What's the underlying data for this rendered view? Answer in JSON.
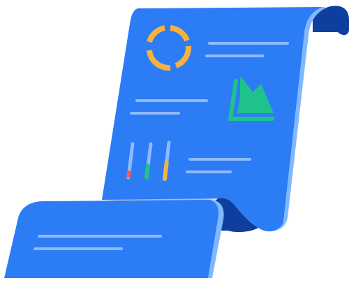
{
  "illustration": {
    "subject": "rolled-report-scroll",
    "icons": [
      "ring-chart-icon",
      "area-chart-icon",
      "progress-bars-icon"
    ],
    "colors": {
      "paper": "#2c7cf6",
      "paper_shade": "#1f5fd0",
      "roll_dark": "#0e3f9e",
      "paper_edge": "#7fb8ff",
      "text_line": "#8fbaff",
      "ring_chart": "#f6b23e",
      "area_chart": "#1fc28a",
      "bar_red": "#f25a5a",
      "bar_green": "#23c27d",
      "bar_orange": "#f6b23e"
    },
    "progress_levels": [
      0.2,
      0.35,
      0.45
    ]
  }
}
